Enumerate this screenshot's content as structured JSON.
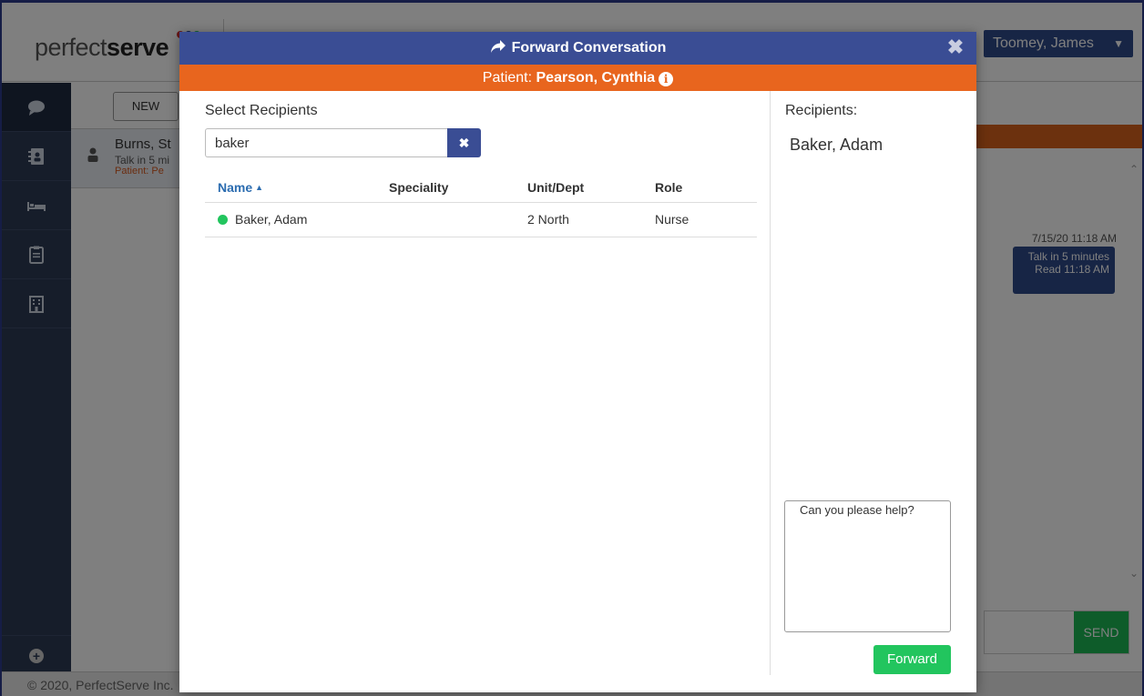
{
  "app": {
    "logo_light": "perfect",
    "logo_bold": "serve",
    "user_name": "Toomey, James",
    "new_button": "NEW",
    "conversation": {
      "name": "Burns, St",
      "message": "Talk in 5 mi",
      "patient": "Patient: Pe"
    },
    "message_bubble": {
      "date": "7/15/20 11:18 AM",
      "text": "Talk in 5 minutes",
      "read": "Read 11:18 AM"
    },
    "send_label": "SEND",
    "footer": "© 2020, PerfectServe Inc."
  },
  "modal": {
    "title": "Forward Conversation",
    "patient_prefix": "Patient: ",
    "patient_name": "Pearson, Cynthia",
    "select_title": "Select Recipients",
    "search_value": "baker",
    "table": {
      "headers": [
        "Name",
        "Speciality",
        "Unit/Dept",
        "Role"
      ],
      "sorted_column": "Name",
      "rows": [
        {
          "name": "Baker, Adam",
          "speciality": "",
          "unit": "2 North",
          "role": "Nurse",
          "status_color": "#22c55e"
        }
      ]
    },
    "recipients_title": "Recipients:",
    "recipients": [
      "Baker, Adam"
    ],
    "message": "Can you please help?",
    "forward_label": "Forward"
  },
  "colors": {
    "header_blue": "#3a4d94",
    "patient_orange": "#e8651e",
    "forward_green": "#22c55e",
    "nav_dark": "#2d3b55"
  },
  "icons": {
    "title_icon": "share-arrow-icon",
    "close_icon": "close-icon",
    "info_icon": "info-icon",
    "clear_icon": "clear-x-icon",
    "nav": [
      "chat-icon",
      "contacts-icon",
      "bed-icon",
      "clipboard-icon",
      "building-icon"
    ]
  }
}
